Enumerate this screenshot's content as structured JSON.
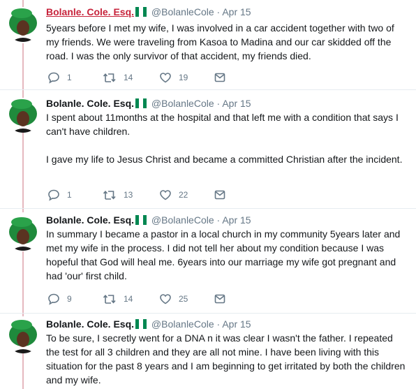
{
  "tweets": [
    {
      "name": "Bolanle. Cole. Esq.",
      "handle": "@BolanleCole",
      "separator": "·",
      "date": "Apr 15",
      "paragraphs": [
        "5years before I met my wife, I was involved in a car accident together with two of my friends. We were traveling from Kasoa to Madina and our car skidded off the road. I was the only survivor of that accident, my friends died."
      ],
      "replies": "1",
      "retweets": "14",
      "likes": "19"
    },
    {
      "name": "Bolanle. Cole. Esq.",
      "handle": "@BolanleCole",
      "separator": "·",
      "date": "Apr 15",
      "paragraphs": [
        "I spent about 11months at the hospital and that left me with a condition that says I can't have children.",
        "I gave my life to Jesus Christ and became a committed Christian after the incident."
      ],
      "replies": "1",
      "retweets": "13",
      "likes": "22"
    },
    {
      "name": "Bolanle. Cole. Esq.",
      "handle": "@BolanleCole",
      "separator": "·",
      "date": "Apr 15",
      "paragraphs": [
        "In summary I became a pastor in a local church in my community 5years later and met my wife in the process. I did not tell her about my condition because I was hopeful that God will heal me. 6years into our marriage my wife got pregnant and had 'our' first child."
      ],
      "replies": "9",
      "retweets": "14",
      "likes": "25"
    },
    {
      "name": "Bolanle. Cole. Esq.",
      "handle": "@BolanleCole",
      "separator": "·",
      "date": "Apr 15",
      "paragraphs": [
        "To be sure, I secretly went for a DNA n it was clear I wasn't the father. I repeated the test for all 3 children and they are all not mine. I have been living with this situation for the past 8 years and I am beginning to get irritated by both the children and my wife."
      ]
    }
  ],
  "colors": {
    "thread_line": "#e5b8bf",
    "name_link": "#c7233b",
    "muted": "#657786",
    "flag_green": "#008751",
    "avatar_green": "#1f8a3c"
  },
  "icons": [
    "avatar-image",
    "nigeria-flag-icon",
    "reply-icon",
    "retweet-icon",
    "like-icon",
    "message-icon"
  ]
}
